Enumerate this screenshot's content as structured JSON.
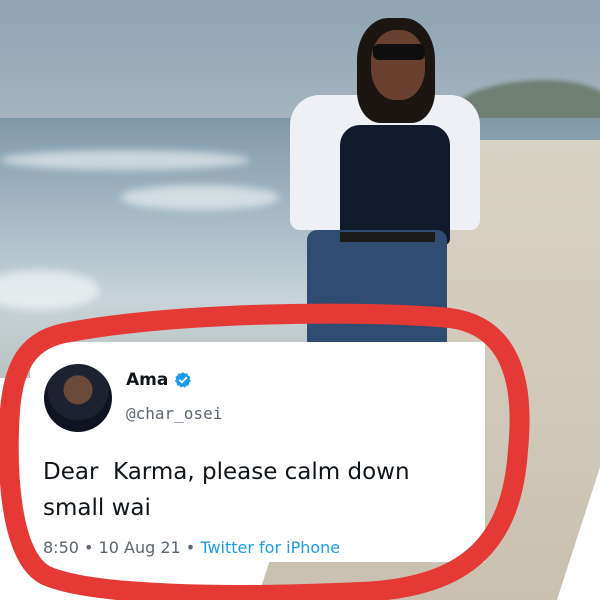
{
  "tweet": {
    "name": "Ama",
    "handle": "@char_osei",
    "text": "Dear  Karma, please calm down\nsmall wai",
    "time": "8:50",
    "separator": "•",
    "date": "10 Aug 21",
    "source": "Twitter for iPhone"
  },
  "colors": {
    "verified": "#1d9bf0",
    "marker": "#e53935",
    "source_link": "#1d9bf0"
  },
  "icons": {
    "verified": "verified-badge-icon",
    "avatar": "profile-photo"
  }
}
